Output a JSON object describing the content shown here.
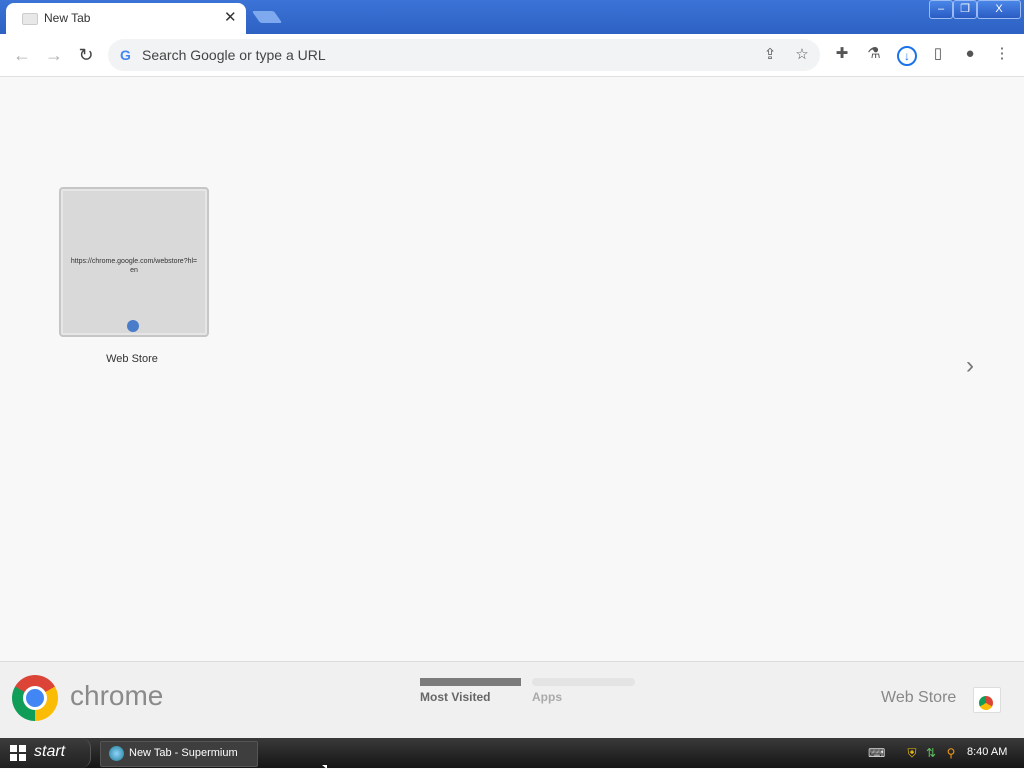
{
  "window": {
    "tab_title": "New Tab",
    "tab_close": "✕",
    "minimize": "–",
    "restore": "❐",
    "close": "X"
  },
  "toolbar": {
    "back": "←",
    "forward": "→",
    "reload": "↻",
    "omnibox_placeholder": "Search Google or type a URL",
    "google_icon": "G",
    "share_icon": "⇪",
    "star_icon": "☆",
    "extensions_icon": "✚",
    "labs_icon": "⚗",
    "download_icon": "↓",
    "sidepanel_icon": "▯",
    "profile_icon": "●",
    "menu_icon": "⋮"
  },
  "most_visited": [
    {
      "title": "Web Store",
      "url": "https://chrome.google.com/webstore?hl=en"
    }
  ],
  "page_nav": {
    "next": "›"
  },
  "footer": {
    "brand": "chrome",
    "tabs": [
      {
        "label": "Most Visited",
        "active": true
      },
      {
        "label": "Apps",
        "active": false
      }
    ],
    "webstore_label": "Web Store"
  },
  "taskbar": {
    "start_label": "start",
    "task_item": "New Tab - Supermium",
    "clock": "8:40 AM"
  }
}
